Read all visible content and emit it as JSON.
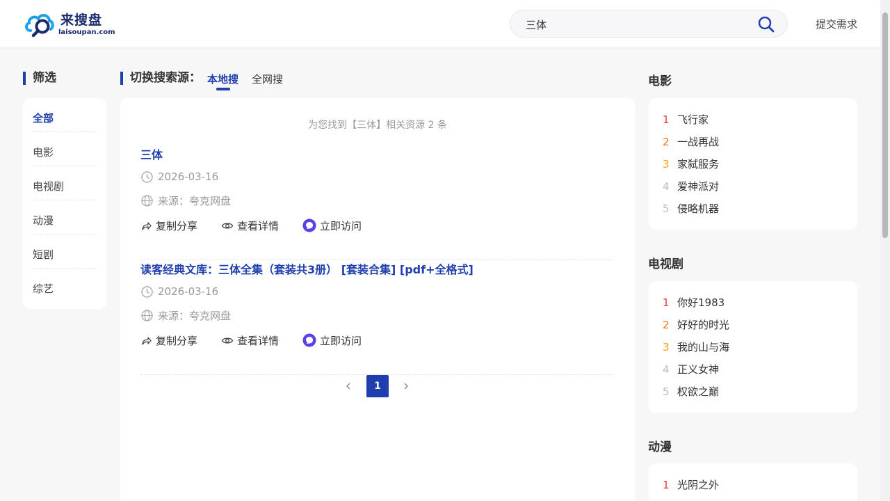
{
  "header": {
    "logo_text": "来搜盘",
    "logo_sub": "laisoupan.com",
    "search_value": "三体",
    "submit_label": "提交需求"
  },
  "filter": {
    "title": "筛选",
    "items": [
      "全部",
      "电影",
      "电视剧",
      "动漫",
      "短剧",
      "综艺"
    ],
    "active": "全部"
  },
  "source": {
    "label": "切换搜索源：",
    "tabs": [
      "本地搜",
      "全网搜"
    ],
    "active": "本地搜"
  },
  "results": {
    "summary": "为您找到【三体】相关资源 2 条",
    "items": [
      {
        "title": "三体",
        "date": "2026-03-16",
        "source": "来源：夸克网盘",
        "share": "复制分享",
        "detail": "查看详情",
        "visit": "立即访问"
      },
      {
        "title": "读客经典文库：三体全集（套装共3册） [套装合集] [pdf+全格式]",
        "date": "2026-03-16",
        "source": "来源：夸克网盘",
        "share": "复制分享",
        "detail": "查看详情",
        "visit": "立即访问"
      }
    ],
    "pagination": {
      "current": "1"
    }
  },
  "rankings": [
    {
      "title": "电影",
      "items": [
        {
          "rank": "1",
          "name": "飞行家"
        },
        {
          "rank": "2",
          "name": "一战再战"
        },
        {
          "rank": "3",
          "name": "家弑服务"
        },
        {
          "rank": "4",
          "name": "爱神派对"
        },
        {
          "rank": "5",
          "name": "侵略机器"
        }
      ]
    },
    {
      "title": "电视剧",
      "items": [
        {
          "rank": "1",
          "name": "你好1983"
        },
        {
          "rank": "2",
          "name": "好好的时光"
        },
        {
          "rank": "3",
          "name": "我的山与海"
        },
        {
          "rank": "4",
          "name": "正义女神"
        },
        {
          "rank": "5",
          "name": "权欲之巅"
        }
      ]
    },
    {
      "title": "动漫",
      "items": [
        {
          "rank": "1",
          "name": "光阴之外"
        }
      ]
    }
  ],
  "colors": {
    "accent": "#1f3fae",
    "rank1": "#e53935",
    "rank2": "#f0731d",
    "rank3": "#f4a100",
    "rank_other": "#bbbbbb",
    "visit_icon": "#5b3fe8"
  },
  "icons": {
    "search": "search-icon",
    "clock": "clock-icon",
    "globe": "globe-icon",
    "share": "share-icon",
    "eye": "eye-icon",
    "visit": "visit-icon",
    "prev": "chevron-left-icon",
    "next": "chevron-right-icon"
  }
}
